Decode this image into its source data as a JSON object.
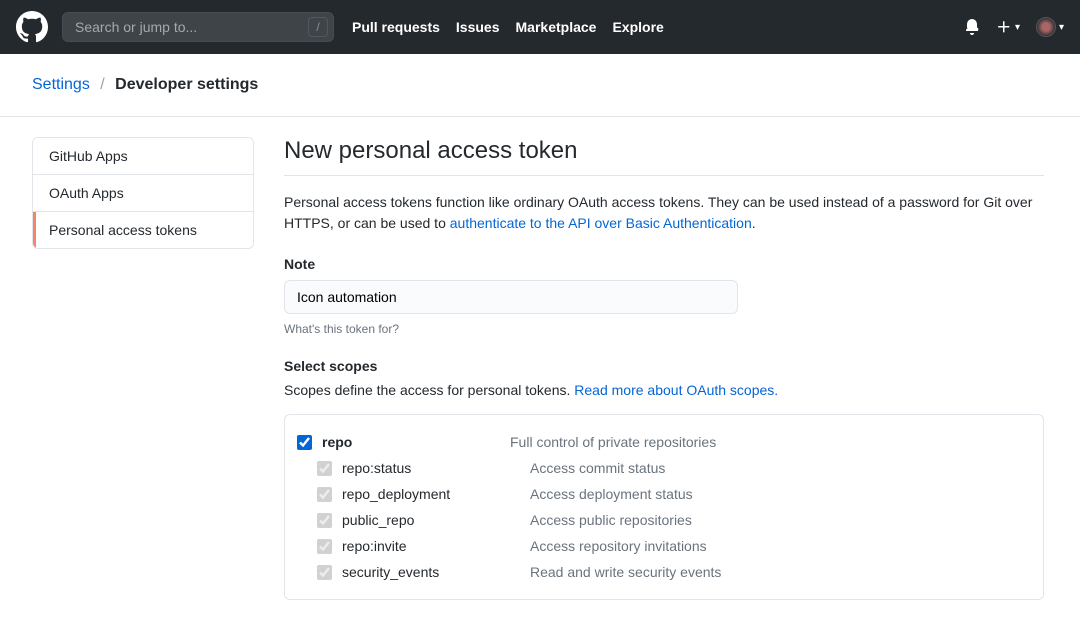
{
  "header": {
    "search_placeholder": "Search or jump to...",
    "nav": [
      "Pull requests",
      "Issues",
      "Marketplace",
      "Explore"
    ]
  },
  "breadcrumb": {
    "settings": "Settings",
    "current": "Developer settings"
  },
  "sidebar": {
    "items": [
      {
        "label": "GitHub Apps",
        "active": false
      },
      {
        "label": "OAuth Apps",
        "active": false
      },
      {
        "label": "Personal access tokens",
        "active": true
      }
    ]
  },
  "page": {
    "title": "New personal access token",
    "intro_before": "Personal access tokens function like ordinary OAuth access tokens. They can be used instead of a password for Git over HTTPS, or can be used to ",
    "intro_link": "authenticate to the API over Basic Authentication",
    "intro_after": ".",
    "note_label": "Note",
    "note_value": "Icon automation",
    "note_hint": "What's this token for?",
    "scopes_label": "Select scopes",
    "scopes_intro_before": "Scopes define the access for personal tokens. ",
    "scopes_intro_link": "Read more about OAuth scopes."
  },
  "scopes": [
    {
      "name": "repo",
      "desc": "Full control of private repositories",
      "checked": true,
      "parent": true,
      "disabled": false
    },
    {
      "name": "repo:status",
      "desc": "Access commit status",
      "checked": true,
      "parent": false,
      "disabled": true
    },
    {
      "name": "repo_deployment",
      "desc": "Access deployment status",
      "checked": true,
      "parent": false,
      "disabled": true
    },
    {
      "name": "public_repo",
      "desc": "Access public repositories",
      "checked": true,
      "parent": false,
      "disabled": true
    },
    {
      "name": "repo:invite",
      "desc": "Access repository invitations",
      "checked": true,
      "parent": false,
      "disabled": true
    },
    {
      "name": "security_events",
      "desc": "Read and write security events",
      "checked": true,
      "parent": false,
      "disabled": true
    }
  ]
}
